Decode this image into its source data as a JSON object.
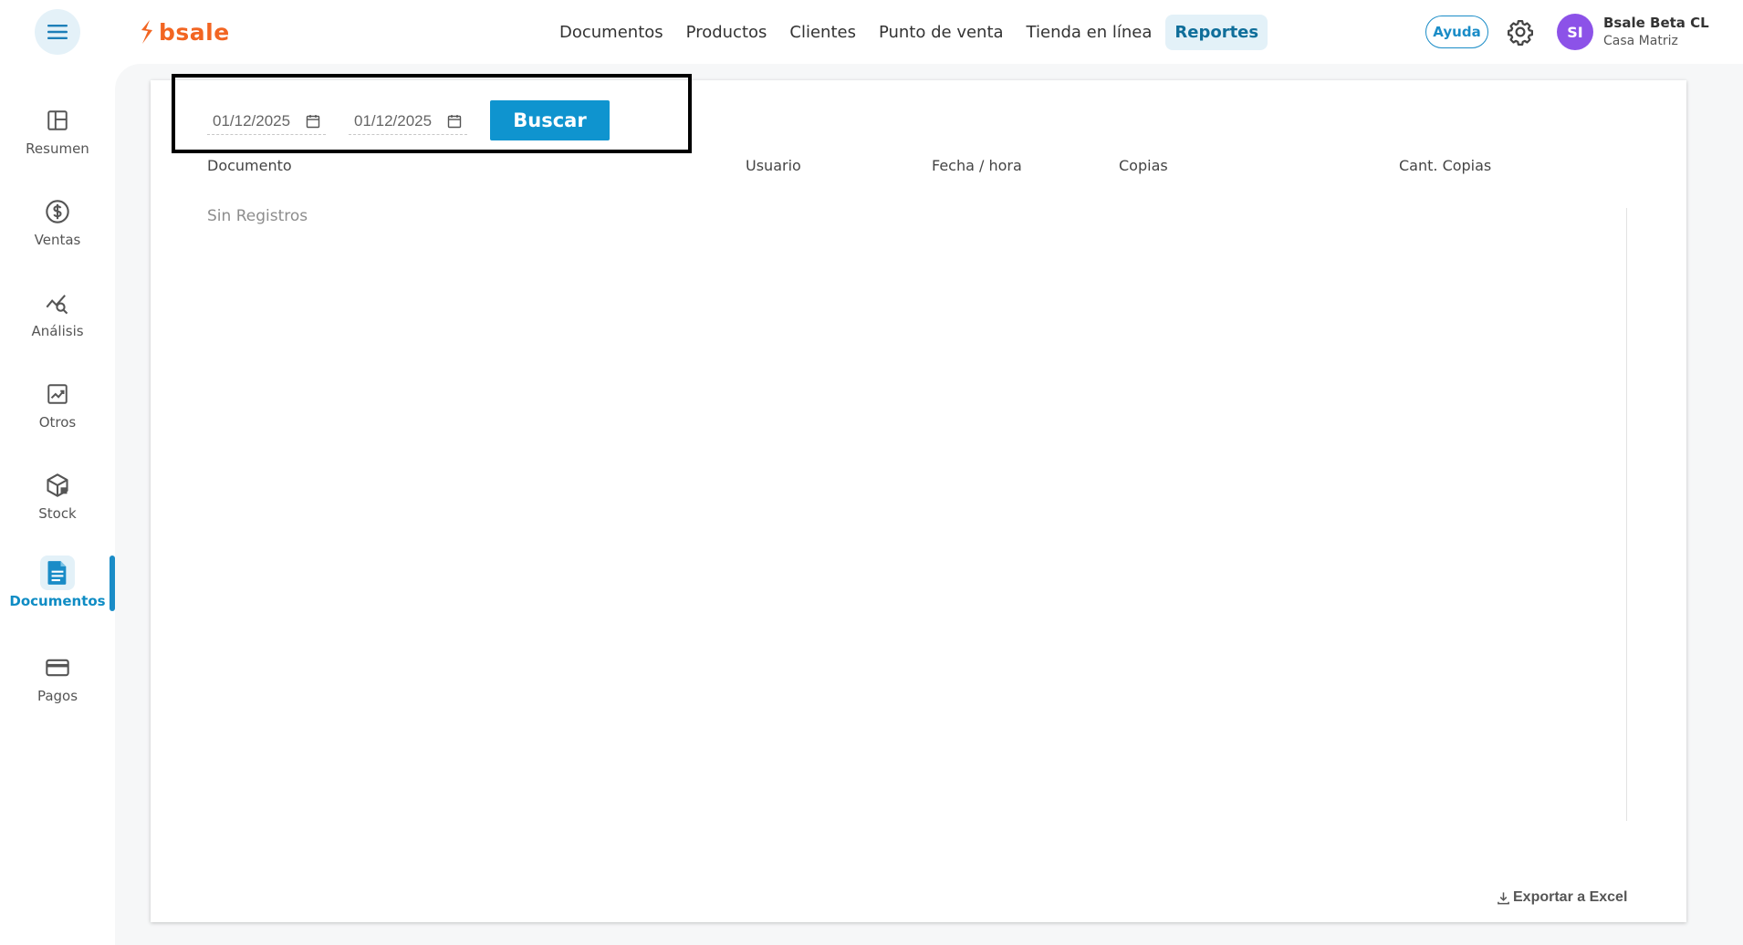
{
  "header": {
    "brand": "bsale",
    "nav": [
      {
        "label": "Documentos",
        "active": false
      },
      {
        "label": "Productos",
        "active": false
      },
      {
        "label": "Clientes",
        "active": false
      },
      {
        "label": "Punto de venta",
        "active": false
      },
      {
        "label": "Tienda en línea",
        "active": false
      },
      {
        "label": "Reportes",
        "active": true
      }
    ],
    "help_label": "Ayuda",
    "user": {
      "initials": "SI",
      "name": "Bsale Beta CL",
      "branch": "Casa Matriz",
      "avatar_color": "#8c52e8"
    }
  },
  "sidebar": {
    "items": [
      {
        "label": "Resumen",
        "icon": "layout-icon",
        "active": false
      },
      {
        "label": "Ventas",
        "icon": "dollar-circle-icon",
        "active": false
      },
      {
        "label": "Análisis",
        "icon": "chart-search-icon",
        "active": false
      },
      {
        "label": "Otros",
        "icon": "trending-chart-icon",
        "active": false
      },
      {
        "label": "Stock",
        "icon": "box-icon",
        "active": false
      },
      {
        "label": "Documentos",
        "icon": "document-icon",
        "active": true
      },
      {
        "label": "Pagos",
        "icon": "credit-card-icon",
        "active": false
      }
    ]
  },
  "filters": {
    "date_from": "01/12/2025",
    "date_to": "01/12/2025",
    "search_label": "Buscar"
  },
  "table": {
    "columns": [
      "Documento",
      "Usuario",
      "Fecha / hora",
      "Copias",
      "Cant. Copias"
    ],
    "empty_message": "Sin Registros"
  },
  "export_label": "Exportar a Excel",
  "colors": {
    "accent": "#0f94cf",
    "brand": "#f26522",
    "active_nav_bg": "#e3f1f8"
  }
}
